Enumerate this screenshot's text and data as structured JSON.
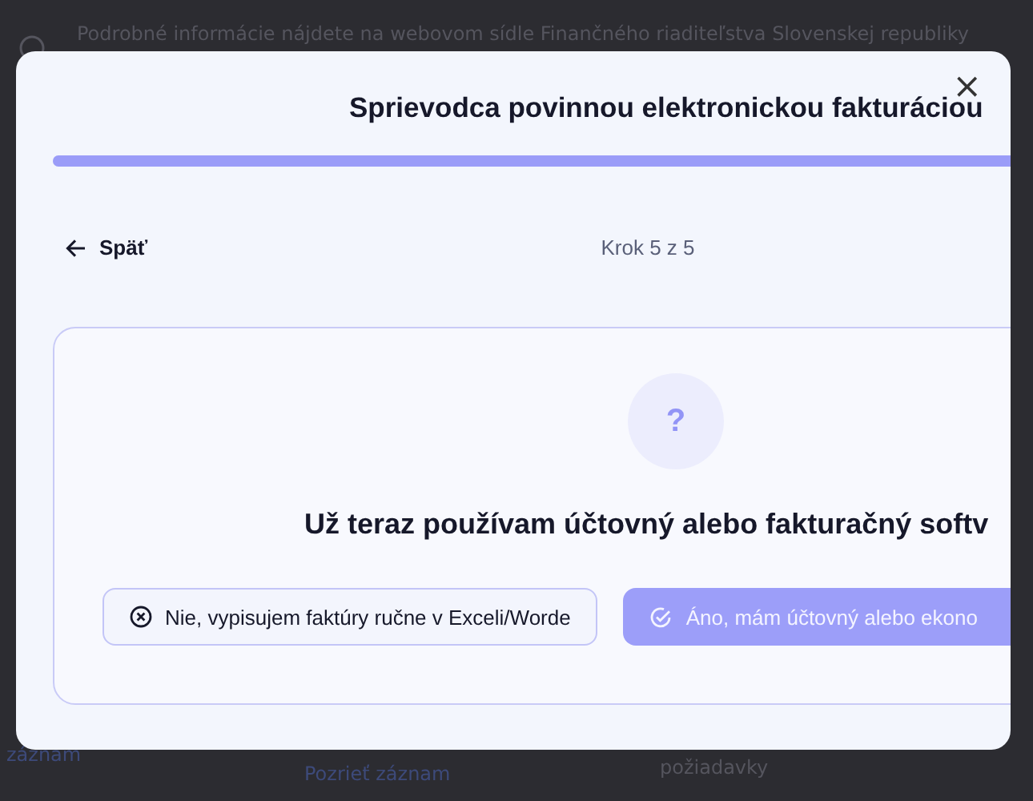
{
  "backdrop": {
    "notice": "Podrobné informácie nájdete na webovom sídle Finančného riaditeľstva Slovenskej republiky",
    "links": [
      {
        "label": "záznam"
      },
      {
        "label": "Pozrieť záznam"
      }
    ],
    "cell_text": "požiadavky"
  },
  "dialog": {
    "title": "Sprievodca povinnou elektronickou fakturáciou",
    "close": "×",
    "progress": {
      "level": 1
    },
    "back": "Späť",
    "step": "Krok 5 z 5",
    "question": {
      "badge": "?",
      "text": "Už teraz používam účtovný alebo fakturačný softv"
    },
    "answers": [
      {
        "kind": "no",
        "label": "Nie, vypisujem faktúry ručne v Exceli/Worde"
      },
      {
        "kind": "yes",
        "label": "Áno, mám účtovný alebo ekono"
      }
    ]
  }
}
